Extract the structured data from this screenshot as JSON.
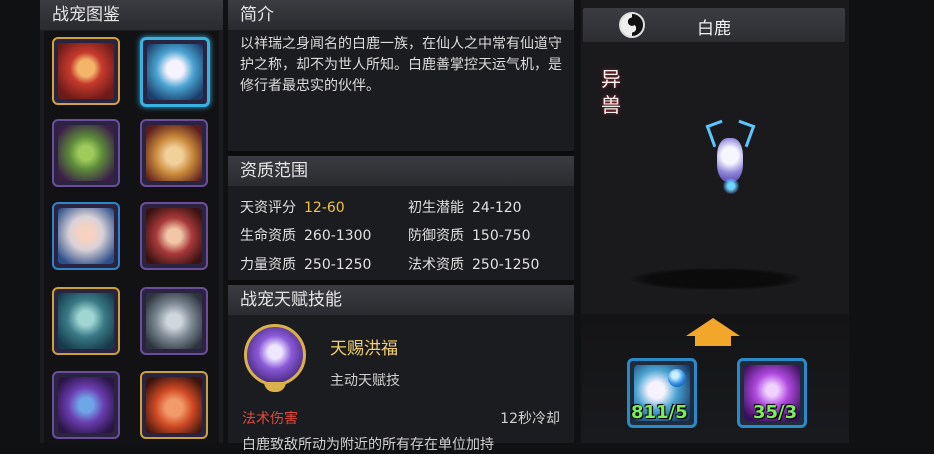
{
  "left_panel": {
    "title": "战宠图鉴",
    "pets": [
      {
        "name": "red-demon",
        "color": "#c83a2d"
      },
      {
        "name": "white-deer",
        "color": "#4aa3d1"
      },
      {
        "name": "green-goblin",
        "color": "#5d8b3a"
      },
      {
        "name": "dog-warrior",
        "color": "#c9893b"
      },
      {
        "name": "white-hair-girl",
        "color": "#d9d2d8"
      },
      {
        "name": "red-hair-girl",
        "color": "#a83a3a"
      },
      {
        "name": "fish-spirit",
        "color": "#3a7a86"
      },
      {
        "name": "grey-beast",
        "color": "#7e8a96"
      },
      {
        "name": "purple-squid",
        "color": "#6a3db0"
      },
      {
        "name": "red-lantern",
        "color": "#cf4a24"
      }
    ]
  },
  "intro": {
    "title": "简介",
    "text": "以祥瑞之身闻名的白鹿一族，在仙人之中常有仙道守护之称，却不为世人所知。白鹿善掌控天运气机，是修行者最忠实的伙伴。"
  },
  "aptitude": {
    "title": "资质范围",
    "rows": [
      {
        "k1": "天资评分",
        "v1": "12-60",
        "k2": "初生潜能",
        "v2": "24-120"
      },
      {
        "k1": "生命资质",
        "v1": "260-1300",
        "k2": "防御资质",
        "v2": "150-750"
      },
      {
        "k1": "力量资质",
        "v1": "250-1250",
        "k2": "法术资质",
        "v2": "250-1250"
      }
    ]
  },
  "skills": {
    "title": "战宠天赋技能",
    "skill_name": "天赐洪福",
    "skill_type": "主动天赋技",
    "damage_type": "法术伤害",
    "cooldown": "12秒冷却",
    "desc_partial": "白鹿致敌所动为附近的所有存在单位加持"
  },
  "detail": {
    "pet_name": "白鹿",
    "tag": "异兽",
    "items": [
      {
        "label": "811/5"
      },
      {
        "label": "35/3"
      }
    ]
  },
  "colors": {
    "accent_yellow": "#f1c53e",
    "accent_blue": "#37b2e3",
    "green": "#7dee5a"
  }
}
